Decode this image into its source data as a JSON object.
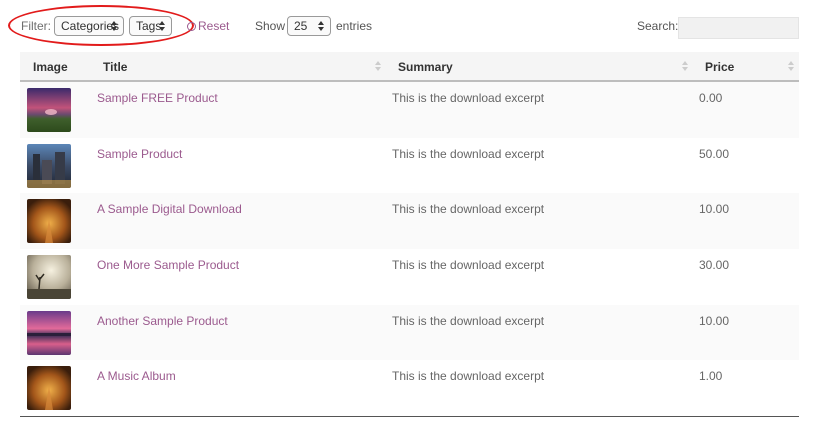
{
  "toolbar": {
    "filter_label": "Filter:",
    "categories_value": "Categories",
    "tags_value": "Tags",
    "reset_label": "Reset",
    "show_label": "Show",
    "entries_value": "25",
    "entries_label": "entries",
    "search_label": "Search:",
    "search_value": "",
    "highlight_color": "#e21b1b",
    "link_color": "#9b5a8e"
  },
  "table": {
    "headers": {
      "image": "Image",
      "title": "Title",
      "summary": "Summary",
      "price": "Price"
    },
    "rows": [
      {
        "title": "Sample FREE Product",
        "summary": "This is the download excerpt",
        "price": "0.00",
        "image": "sunset-field"
      },
      {
        "title": "Sample Product",
        "summary": "This is the download excerpt",
        "price": "50.00",
        "image": "city-street"
      },
      {
        "title": "A Sample Digital Download",
        "summary": "This is the download excerpt",
        "price": "10.00",
        "image": "autumn-trees"
      },
      {
        "title": "One More Sample Product",
        "summary": "This is the download excerpt",
        "price": "30.00",
        "image": "foggy-tree"
      },
      {
        "title": "Another Sample Product",
        "summary": "This is the download excerpt",
        "price": "10.00",
        "image": "pink-lake"
      },
      {
        "title": "A Music Album",
        "summary": "This is the download excerpt",
        "price": "1.00",
        "image": "autumn-trees"
      }
    ]
  }
}
